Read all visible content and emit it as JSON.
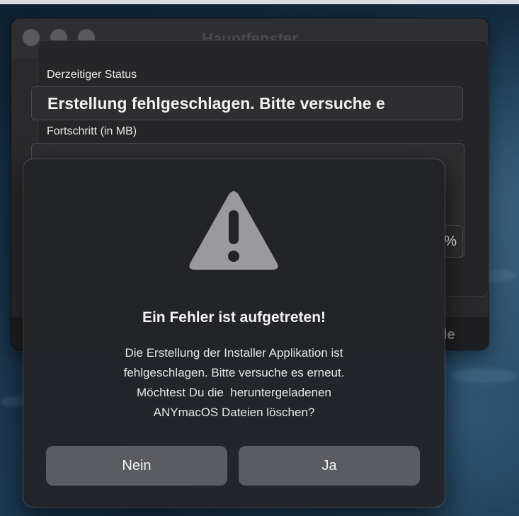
{
  "window": {
    "title": "Hauptfenster"
  },
  "status": {
    "label": "Derzeitiger Status",
    "value": "Erstellung fehlgeschlagen. Bitte versuche e"
  },
  "progress": {
    "label": "Fortschritt (in MB)",
    "percent_suffix": "%"
  },
  "bottom_bar": {
    "partial_button_text": "le"
  },
  "alert": {
    "icon": "warning-triangle-icon",
    "title": "Ein Fehler ist aufgetreten!",
    "message_lines": [
      "Die Erstellung der Installer Applikation ist",
      "fehlgeschlagen. Bitte versuche es erneut.",
      "Möchtest Du die  heruntergeladenen",
      "ANYmacOS Dateien löschen?"
    ],
    "buttons": {
      "no": "Nein",
      "yes": "Ja"
    }
  },
  "colors": {
    "window_bg": "#2a2a2c",
    "alert_bg": "#222428",
    "button_bg": "#5a5c61",
    "icon_gray": "#9a9a9c"
  }
}
